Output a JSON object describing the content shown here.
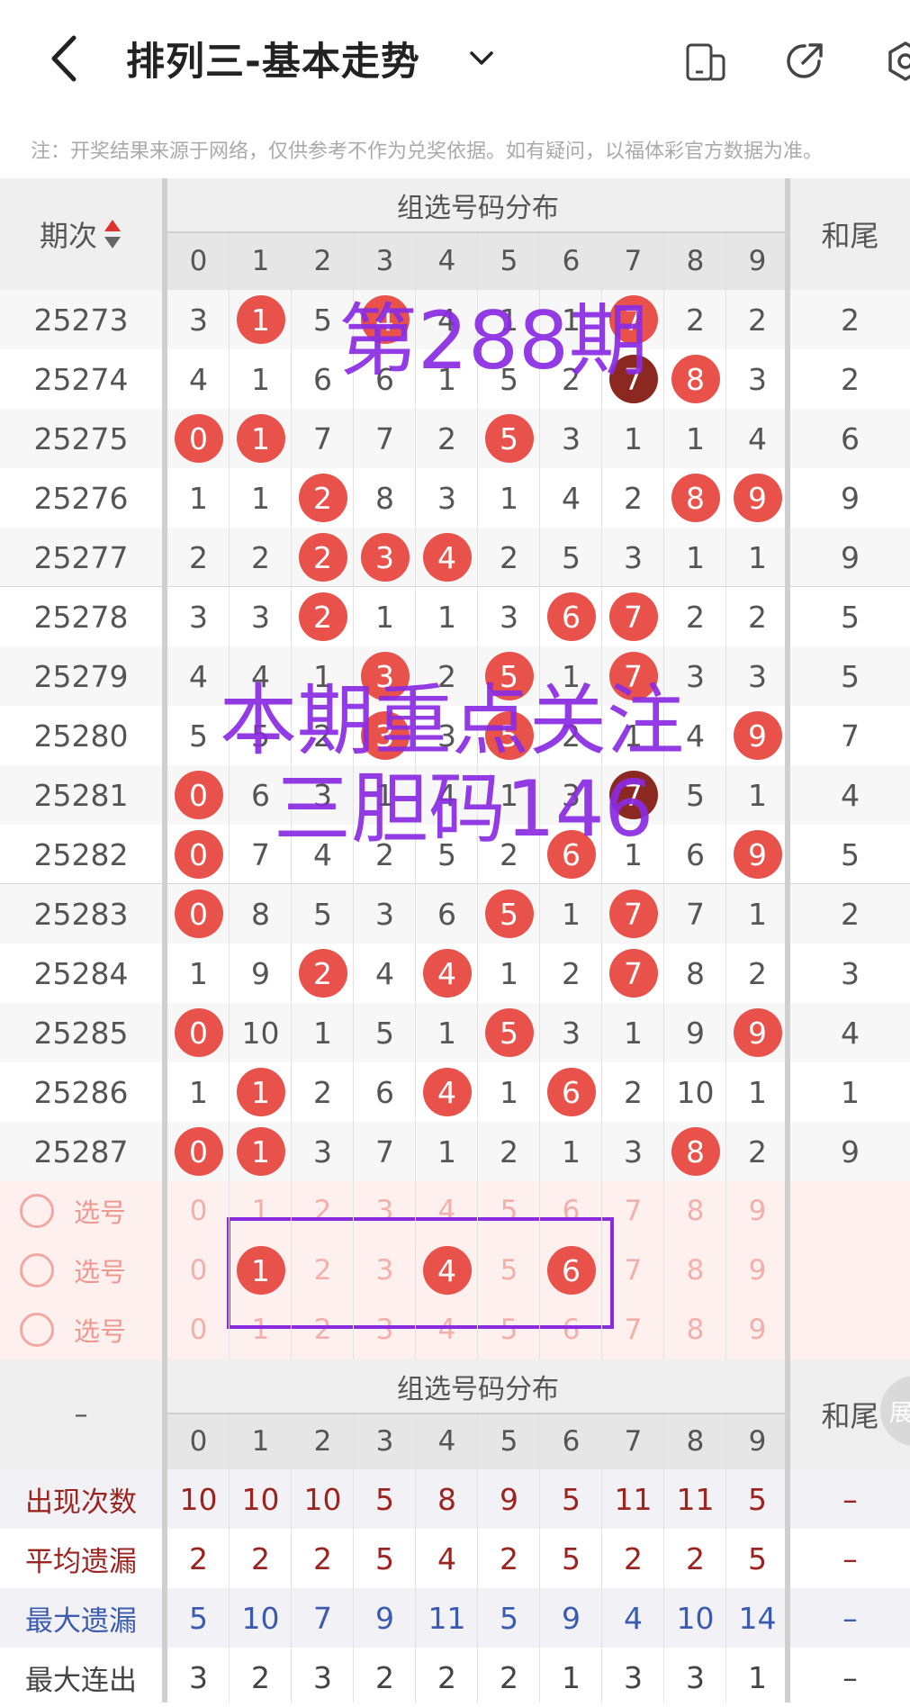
{
  "header": {
    "title": "排列三-基本走势",
    "icons": [
      "back-arrow-icon",
      "chevron-down-icon",
      "phone-layout-icon",
      "share-icon",
      "settings-icon"
    ]
  },
  "notice": "注：开奖结果来源于网络，仅供参考不作为兑奖依据。如有疑问，以福体彩官方数据为准。",
  "table": {
    "period_header": "期次",
    "group_header": "组选号码分布",
    "tail_header": "和尾",
    "digits": [
      "0",
      "1",
      "2",
      "3",
      "4",
      "5",
      "6",
      "7",
      "8",
      "9"
    ],
    "rows": [
      {
        "period": "25273",
        "cells": [
          [
            "3",
            0
          ],
          [
            "1",
            1
          ],
          [
            "5",
            0
          ],
          [
            "4",
            1
          ],
          [
            "4",
            0
          ],
          [
            "1",
            0
          ],
          [
            "1",
            0
          ],
          [
            "7",
            1
          ],
          [
            "2",
            0
          ],
          [
            "2",
            0
          ]
        ],
        "tail": "2"
      },
      {
        "period": "25274",
        "cells": [
          [
            "4",
            0
          ],
          [
            "1",
            0
          ],
          [
            "6",
            0
          ],
          [
            "6",
            0
          ],
          [
            "1",
            0
          ],
          [
            "5",
            0
          ],
          [
            "2",
            0
          ],
          [
            "7",
            2
          ],
          [
            "8",
            1
          ],
          [
            "3",
            0
          ]
        ],
        "tail": "2"
      },
      {
        "period": "25275",
        "cells": [
          [
            "0",
            1
          ],
          [
            "1",
            1
          ],
          [
            "7",
            0
          ],
          [
            "7",
            0
          ],
          [
            "2",
            0
          ],
          [
            "5",
            1
          ],
          [
            "3",
            0
          ],
          [
            "1",
            0
          ],
          [
            "1",
            0
          ],
          [
            "4",
            0
          ]
        ],
        "tail": "6"
      },
      {
        "period": "25276",
        "cells": [
          [
            "1",
            0
          ],
          [
            "1",
            0
          ],
          [
            "2",
            1
          ],
          [
            "8",
            0
          ],
          [
            "3",
            0
          ],
          [
            "1",
            0
          ],
          [
            "4",
            0
          ],
          [
            "2",
            0
          ],
          [
            "8",
            1
          ],
          [
            "9",
            1
          ]
        ],
        "tail": "9"
      },
      {
        "period": "25277",
        "cells": [
          [
            "2",
            0
          ],
          [
            "2",
            0
          ],
          [
            "2",
            1
          ],
          [
            "3",
            1
          ],
          [
            "4",
            1
          ],
          [
            "2",
            0
          ],
          [
            "5",
            0
          ],
          [
            "3",
            0
          ],
          [
            "1",
            0
          ],
          [
            "1",
            0
          ]
        ],
        "tail": "9"
      },
      {
        "period": "25278",
        "cells": [
          [
            "3",
            0
          ],
          [
            "3",
            0
          ],
          [
            "2",
            1
          ],
          [
            "1",
            0
          ],
          [
            "1",
            0
          ],
          [
            "3",
            0
          ],
          [
            "6",
            1
          ],
          [
            "7",
            1
          ],
          [
            "2",
            0
          ],
          [
            "2",
            0
          ]
        ],
        "tail": "5"
      },
      {
        "period": "25279",
        "cells": [
          [
            "4",
            0
          ],
          [
            "4",
            0
          ],
          [
            "1",
            0
          ],
          [
            "3",
            1
          ],
          [
            "2",
            0
          ],
          [
            "5",
            1
          ],
          [
            "1",
            0
          ],
          [
            "7",
            1
          ],
          [
            "3",
            0
          ],
          [
            "3",
            0
          ]
        ],
        "tail": "5"
      },
      {
        "period": "25280",
        "cells": [
          [
            "5",
            0
          ],
          [
            "5",
            0
          ],
          [
            "2",
            0
          ],
          [
            "3",
            1
          ],
          [
            "3",
            0
          ],
          [
            "5",
            1
          ],
          [
            "2",
            0
          ],
          [
            "1",
            0
          ],
          [
            "4",
            0
          ],
          [
            "9",
            1
          ]
        ],
        "tail": "7"
      },
      {
        "period": "25281",
        "cells": [
          [
            "0",
            1
          ],
          [
            "6",
            0
          ],
          [
            "3",
            0
          ],
          [
            "1",
            0
          ],
          [
            "4",
            0
          ],
          [
            "1",
            0
          ],
          [
            "3",
            0
          ],
          [
            "7",
            2
          ],
          [
            "5",
            0
          ],
          [
            "1",
            0
          ]
        ],
        "tail": "4"
      },
      {
        "period": "25282",
        "cells": [
          [
            "0",
            1
          ],
          [
            "7",
            0
          ],
          [
            "4",
            0
          ],
          [
            "2",
            0
          ],
          [
            "5",
            0
          ],
          [
            "2",
            0
          ],
          [
            "6",
            1
          ],
          [
            "1",
            0
          ],
          [
            "6",
            0
          ],
          [
            "9",
            1
          ]
        ],
        "tail": "5"
      },
      {
        "period": "25283",
        "cells": [
          [
            "0",
            1
          ],
          [
            "8",
            0
          ],
          [
            "5",
            0
          ],
          [
            "3",
            0
          ],
          [
            "6",
            0
          ],
          [
            "5",
            1
          ],
          [
            "1",
            0
          ],
          [
            "7",
            1
          ],
          [
            "7",
            0
          ],
          [
            "1",
            0
          ]
        ],
        "tail": "2"
      },
      {
        "period": "25284",
        "cells": [
          [
            "1",
            0
          ],
          [
            "9",
            0
          ],
          [
            "2",
            1
          ],
          [
            "4",
            0
          ],
          [
            "4",
            1
          ],
          [
            "1",
            0
          ],
          [
            "2",
            0
          ],
          [
            "7",
            1
          ],
          [
            "8",
            0
          ],
          [
            "2",
            0
          ]
        ],
        "tail": "3"
      },
      {
        "period": "25285",
        "cells": [
          [
            "0",
            1
          ],
          [
            "10",
            0
          ],
          [
            "1",
            0
          ],
          [
            "5",
            0
          ],
          [
            "1",
            0
          ],
          [
            "5",
            1
          ],
          [
            "3",
            0
          ],
          [
            "1",
            0
          ],
          [
            "9",
            0
          ],
          [
            "9",
            1
          ]
        ],
        "tail": "4"
      },
      {
        "period": "25286",
        "cells": [
          [
            "1",
            0
          ],
          [
            "1",
            1
          ],
          [
            "2",
            0
          ],
          [
            "6",
            0
          ],
          [
            "4",
            1
          ],
          [
            "1",
            0
          ],
          [
            "6",
            1
          ],
          [
            "2",
            0
          ],
          [
            "10",
            0
          ],
          [
            "1",
            0
          ]
        ],
        "tail": "1"
      },
      {
        "period": "25287",
        "cells": [
          [
            "0",
            1
          ],
          [
            "1",
            1
          ],
          [
            "3",
            0
          ],
          [
            "7",
            0
          ],
          [
            "1",
            0
          ],
          [
            "2",
            0
          ],
          [
            "1",
            0
          ],
          [
            "3",
            0
          ],
          [
            "8",
            1
          ],
          [
            "2",
            0
          ]
        ],
        "tail": "9"
      }
    ],
    "select_label": "选号",
    "select_rows": [
      [],
      [
        "1",
        "4",
        "6"
      ],
      []
    ],
    "stats": [
      {
        "label": "出现次数",
        "color": "#9b2420",
        "values": [
          "10",
          "10",
          "10",
          "5",
          "8",
          "9",
          "5",
          "11",
          "11",
          "5"
        ],
        "tail": "–"
      },
      {
        "label": "平均遗漏",
        "color": "#9b2420",
        "values": [
          "2",
          "2",
          "2",
          "5",
          "4",
          "2",
          "5",
          "2",
          "2",
          "5"
        ],
        "tail": "–"
      },
      {
        "label": "最大遗漏",
        "color": "#3b5bb0",
        "values": [
          "5",
          "10",
          "7",
          "9",
          "11",
          "5",
          "9",
          "4",
          "10",
          "14"
        ],
        "tail": "–"
      },
      {
        "label": "最大连出",
        "color": "#444444",
        "values": [
          "3",
          "2",
          "3",
          "2",
          "2",
          "2",
          "1",
          "3",
          "3",
          "1"
        ],
        "tail": "–"
      }
    ],
    "bottom_left_dash": "–",
    "side_tab_text": "展"
  },
  "overlay": {
    "period_text": "第288期",
    "focus_line1": "本期重点关注",
    "focus_line2": "三胆码146"
  },
  "colors": {
    "ball": "#e8524a",
    "ball_dark": "#8b2820",
    "overlay": "#8a2be2"
  }
}
